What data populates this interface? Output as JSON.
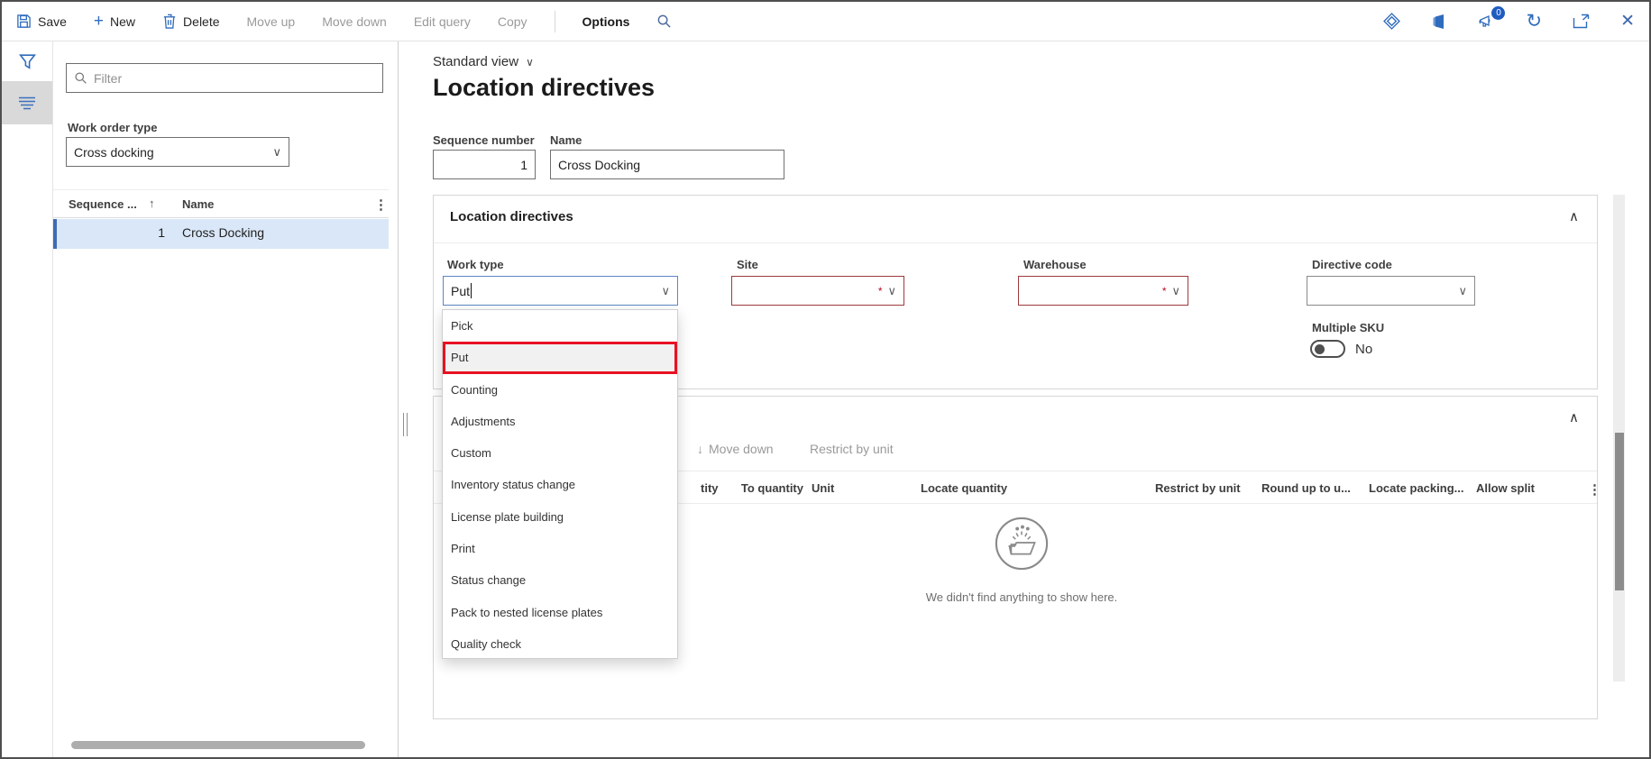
{
  "colors": {
    "accent_blue": "#2f6cbd",
    "disabled_text": "#9a9a9a",
    "required_red": "#9e3a3e",
    "highlight_red": "#e81123",
    "focus_blue": "#5f87c3",
    "selected_row_bg": "#d9e7f8",
    "selected_row_bar": "#3d6cb4",
    "badge_blue": "#1f5cc0"
  },
  "icons": {
    "plus": "+",
    "chevron_down": "∨",
    "chevron_up": "∧",
    "sort_up_arrow": "↑",
    "down_arrow": "↓",
    "overflow_dots": "⋮",
    "refresh": "↻",
    "close": "✕",
    "required_asterisk": "*"
  },
  "app_bar": {
    "save": "Save",
    "new": "New",
    "delete": "Delete",
    "move_up": "Move up",
    "move_down": "Move down",
    "edit_query": "Edit query",
    "copy": "Copy",
    "options": "Options",
    "notification_count": "0"
  },
  "left_panel": {
    "filter_placeholder": "Filter",
    "work_order_type": {
      "label": "Work order type",
      "value": "Cross docking"
    },
    "grid": {
      "col_sequence": "Sequence ...",
      "col_name": "Name",
      "rows": [
        {
          "sequence": "1",
          "name": "Cross Docking"
        }
      ]
    }
  },
  "header": {
    "view_selector": "Standard view",
    "page_title": "Location directives",
    "sequence_number_label": "Sequence number",
    "sequence_number_value": "1",
    "name_label": "Name",
    "name_value": "Cross Docking"
  },
  "section1": {
    "title": "Location directives",
    "fields": {
      "work_type": {
        "label": "Work type",
        "value": "Put"
      },
      "site": {
        "label": "Site"
      },
      "warehouse": {
        "label": "Warehouse"
      },
      "directive_code": {
        "label": "Directive code"
      },
      "multiple_sku": {
        "label": "Multiple SKU",
        "value": "No"
      }
    },
    "work_type_dropdown": {
      "selected": "Put",
      "items": [
        "Pick",
        "Put",
        "Counting",
        "Adjustments",
        "Custom",
        "Inventory status change",
        "License plate building",
        "Print",
        "Status change",
        "Pack to nested license plates",
        "Quality check"
      ]
    }
  },
  "section2": {
    "toolbar": {
      "move_down": "Move down",
      "restrict_by_unit": "Restrict by unit"
    },
    "grid": {
      "columns": [
        "tity",
        "To quantity",
        "Unit",
        "Locate quantity",
        "Restrict by unit",
        "Round up to u...",
        "Locate packing...",
        "Allow split"
      ],
      "empty_message": "We didn't find anything to show here."
    }
  }
}
